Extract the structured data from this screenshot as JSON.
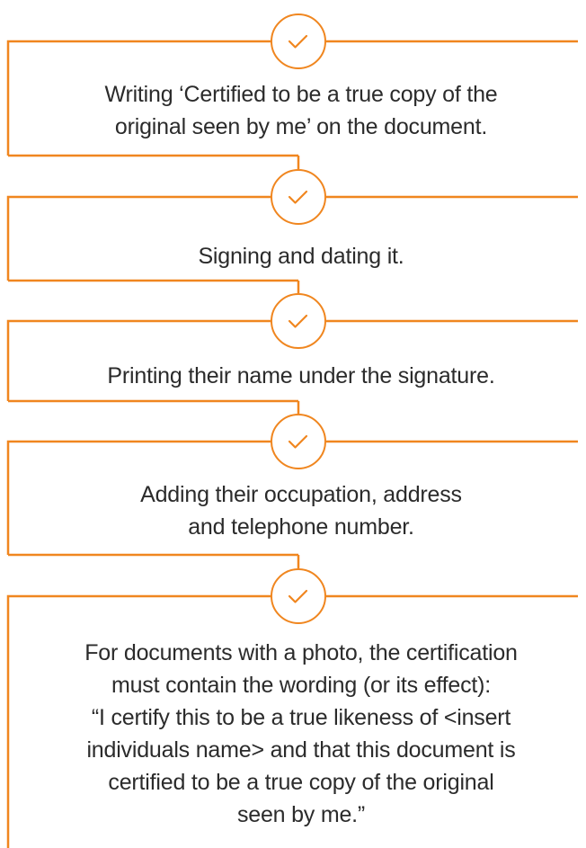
{
  "accent_color": "#f0861f",
  "icons": [
    "check-icon"
  ],
  "steps": [
    {
      "lines": [
        "Writing ‘Certified to be a true copy of the",
        "original seen by me’ on the document."
      ]
    },
    {
      "lines": [
        "Signing and dating it."
      ]
    },
    {
      "lines": [
        "Printing their name under the signature."
      ]
    },
    {
      "lines": [
        "Adding their occupation, address",
        "and telephone number."
      ]
    },
    {
      "lines": [
        "For documents with a photo, the certification",
        "must contain the wording (or its effect):",
        "“I certify this to be a true likeness of <insert",
        "individuals name> and that this document is",
        "certified to be a true copy of the original",
        "seen by me.”"
      ]
    }
  ]
}
